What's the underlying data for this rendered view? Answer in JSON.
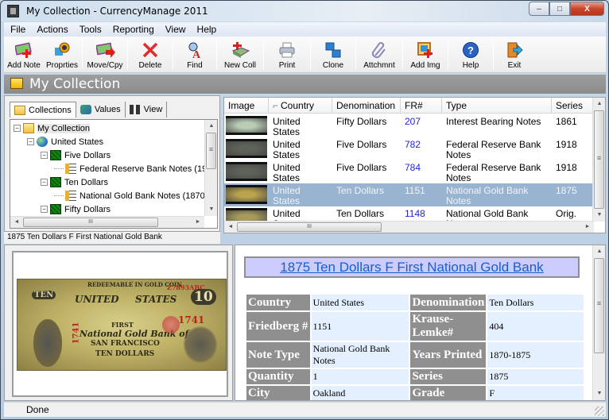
{
  "window": {
    "title": "My Collection - CurrencyManage 2011",
    "controls": {
      "minimize": "–",
      "maximize": "□",
      "close": "X"
    }
  },
  "menu": [
    "File",
    "Actions",
    "Tools",
    "Reporting",
    "View",
    "Help"
  ],
  "toolbar": {
    "buttons": [
      {
        "label": "Add Note",
        "icon": "add-note-icon"
      },
      {
        "label": "Proprties",
        "icon": "properties-icon"
      },
      {
        "label": "Move/Cpy",
        "icon": "move-copy-icon"
      },
      {
        "label": "Delete",
        "icon": "delete-icon"
      },
      {
        "label": "Find",
        "icon": "find-icon"
      },
      {
        "label": "New Coll",
        "icon": "new-collection-icon"
      },
      {
        "label": "Print",
        "icon": "print-icon"
      },
      {
        "label": "Clone",
        "icon": "clone-icon"
      },
      {
        "label": "Attchmnt",
        "icon": "attachment-icon"
      },
      {
        "label": "Add Img",
        "icon": "add-image-icon"
      },
      {
        "label": "Help",
        "icon": "help-icon"
      },
      {
        "label": "Exit",
        "icon": "exit-icon"
      }
    ]
  },
  "header": {
    "title": "My Collection"
  },
  "left_tabs": [
    {
      "label": "Collections",
      "icon": "folder-icon",
      "active": true
    },
    {
      "label": "Values",
      "icon": "values-icon",
      "active": false
    },
    {
      "label": "View",
      "icon": "binoculars-icon",
      "active": false
    }
  ],
  "tree": [
    {
      "label": "My Collection",
      "level": 0,
      "expander": "−",
      "icon": "folder-icon"
    },
    {
      "label": "United States",
      "level": 1,
      "expander": "−",
      "icon": "globe-icon"
    },
    {
      "label": "Five Dollars",
      "level": 2,
      "expander": "−",
      "icon": "banknote-icon"
    },
    {
      "label": "Federal Reserve Bank Notes (19",
      "level": 3,
      "expander": "",
      "icon": "note-type-icon"
    },
    {
      "label": "Ten Dollars",
      "level": 2,
      "expander": "−",
      "icon": "banknote-icon"
    },
    {
      "label": "National Gold Bank Notes (1870",
      "level": 3,
      "expander": "",
      "icon": "note-type-icon"
    },
    {
      "label": "Fifty Dollars",
      "level": 2,
      "expander": "−",
      "icon": "banknote-icon"
    }
  ],
  "scroll": {
    "grip": "≡",
    "hgrip": "III",
    "up": "▲",
    "down": "▼",
    "left": "◄",
    "right": "►"
  },
  "selected_summary": "1875   Ten Dollars   F   First National Gold Bank",
  "grid": {
    "columns": [
      "Image",
      "Country",
      "Denomination",
      "FR#",
      "Type",
      "Series"
    ],
    "sort_indicator": "⌐",
    "rows": [
      {
        "country": "United States",
        "denomination": "Fifty Dollars",
        "fr": "207",
        "type": "Interest Bearing Notes",
        "series": "1861",
        "thumb": "#b9cdb5",
        "selected": false
      },
      {
        "country": "United States",
        "denomination": "Five Dollars",
        "fr": "782",
        "type": "Federal Reserve Bank Notes",
        "series": "1918",
        "thumb": "#5d6359",
        "selected": false
      },
      {
        "country": "United States",
        "denomination": "Five Dollars",
        "fr": "784",
        "type": "Federal Reserve Bank Notes",
        "series": "1918",
        "thumb": "#5d6359",
        "selected": false
      },
      {
        "country": "United States",
        "denomination": "Ten Dollars",
        "fr": "1151",
        "type": "National Gold Bank Notes",
        "series": "1875",
        "thumb": "#b9a34c",
        "selected": true
      },
      {
        "country": "United States",
        "denomination": "Ten Dollars",
        "fr": "1148",
        "type": "National Gold Bank Notes",
        "series": "Orig.",
        "thumb": "#a79a5c",
        "selected": false
      }
    ]
  },
  "banknote": {
    "top": "REDEEMABLE IN GOLD COIN",
    "serial": "Z7893ABC",
    "united": "UNITED",
    "states": "STATES",
    "ten": "TEN",
    "denom_num": "10",
    "first": "FIRST",
    "bank": "National Gold Bank of",
    "city": "SAN FRANCISCO",
    "dollars": "TEN DOLLARS",
    "number": "1741"
  },
  "details": {
    "title": "1875 Ten Dollars F First National Gold Bank",
    "rows": [
      [
        {
          "label": "Country",
          "value": "United States"
        },
        {
          "label": "Denomination",
          "value": "Ten Dollars"
        }
      ],
      [
        {
          "label": "Friedberg #",
          "value": "1151"
        },
        {
          "label": "Krause-Lemke#",
          "value": "404"
        }
      ],
      [
        {
          "label": "Note Type",
          "value": "National Gold Bank Notes"
        },
        {
          "label": "Years Printed",
          "value": "1870-1875"
        }
      ],
      [
        {
          "label": "Quantity",
          "value": "1"
        },
        {
          "label": "Series",
          "value": "1875"
        }
      ],
      [
        {
          "label": "City",
          "value": "Oakland"
        },
        {
          "label": "Grade",
          "value": "F"
        }
      ]
    ]
  },
  "status": {
    "text": "Done"
  },
  "colors": {
    "selection": "#99b4d1",
    "link": "#1a5fc8",
    "fr_number": "#2323d8",
    "header_band": "#959595",
    "detail_label_bg": "#8f8f8f",
    "detail_value_bg": "#e4f0ff",
    "detail_title_bg": "#ccccff"
  }
}
